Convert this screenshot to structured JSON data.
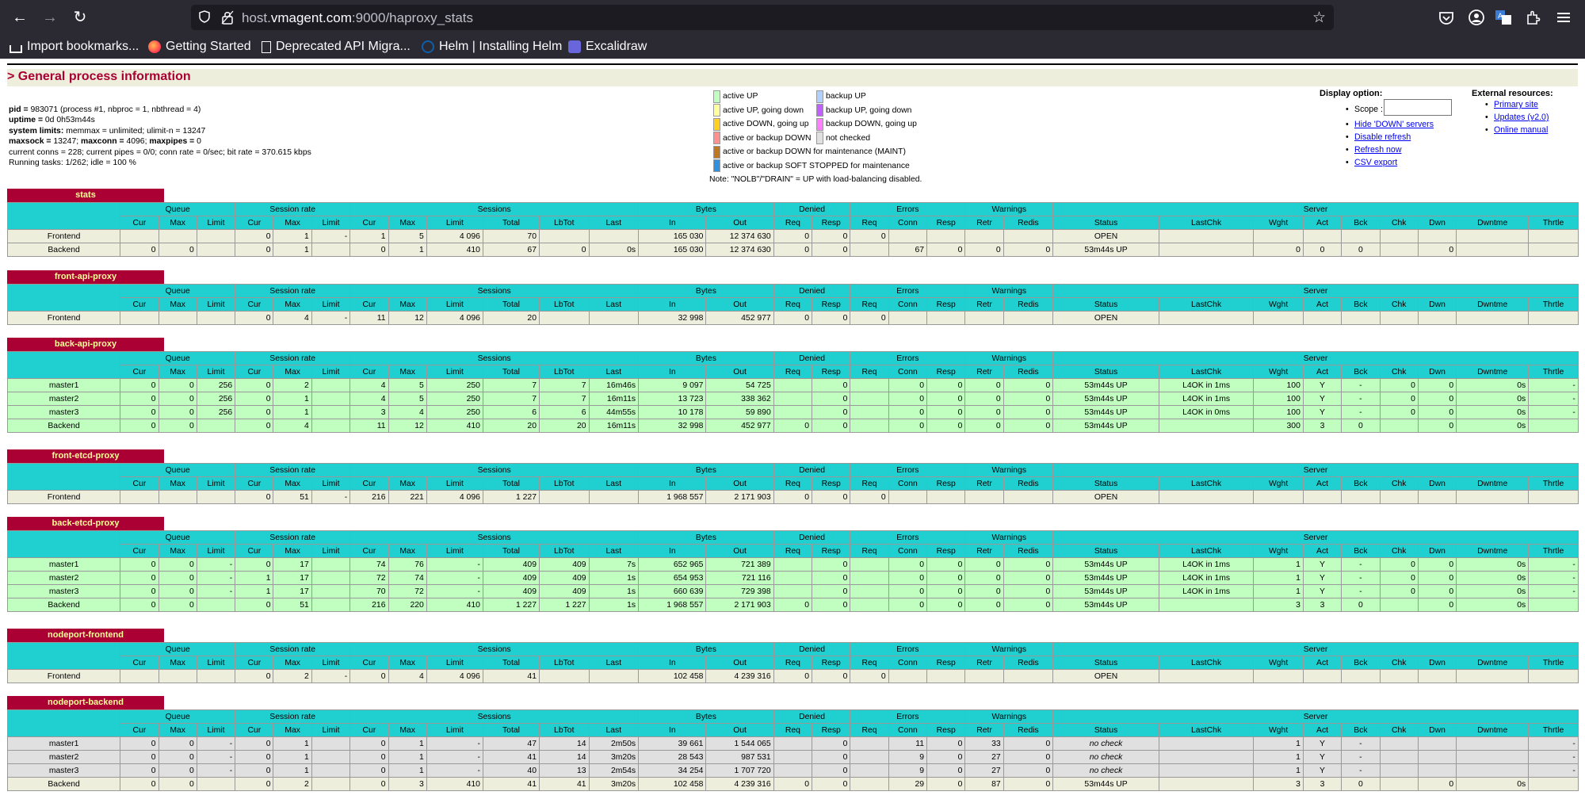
{
  "browser": {
    "url_host": "host.",
    "url_domain": "vmagent.com",
    "url_rest": ":9000/haproxy_stats",
    "bookmarks": [
      "Import bookmarks...",
      "Getting Started",
      "Deprecated API Migra...",
      "Helm | Installing Helm",
      "Excalidraw"
    ]
  },
  "general": {
    "title": "> General process information",
    "lines": [
      {
        "b": "pid = ",
        "t": "983071 (process #1, nbproc = 1, nbthread = 4)"
      },
      {
        "b": "uptime = ",
        "t": "0d 0h53m44s"
      },
      {
        "b": "system limits:",
        "t": " memmax = unlimited; ulimit-n = 13247"
      },
      {
        "b": "maxsock = ",
        "t": "13247; ",
        "b2": "maxconn = ",
        "t2": "4096; ",
        "b3": "maxpipes = ",
        "t3": "0"
      },
      {
        "b": "",
        "t": "current conns = 228; current pipes = 0/0; conn rate = 0/sec; bit rate = 370.615 kbps"
      },
      {
        "b": "",
        "t": "Running tasks: 1/262; idle = 100 %"
      }
    ]
  },
  "legend": {
    "items": [
      {
        "label": "active UP",
        "color": "#c0ffc0"
      },
      {
        "label": "active UP, going down",
        "color": "#ffffa0"
      },
      {
        "label": "active DOWN, going up",
        "color": "#ffd020"
      },
      {
        "label": "active or backup DOWN",
        "color": "#ff9090"
      },
      {
        "label": "active or backup DOWN for maintenance (MAINT)",
        "color": "#c07820"
      },
      {
        "label": "active or backup SOFT STOPPED for maintenance",
        "color": "#3090e0"
      },
      {
        "label": "backup UP",
        "color": "#b0d0ff"
      },
      {
        "label": "backup UP, going down",
        "color": "#c060ff"
      },
      {
        "label": "backup DOWN, going up",
        "color": "#ff80ff"
      },
      {
        "label": "not checked",
        "color": "#e0e0e0"
      }
    ],
    "note": "Note: \"NOLB\"/\"DRAIN\" = UP with load-balancing disabled."
  },
  "display": {
    "heading": "Display option:",
    "scope_label": "Scope :",
    "links": [
      "Hide 'DOWN' servers",
      "Disable refresh",
      "Refresh now",
      "CSV export"
    ]
  },
  "external": {
    "heading": "External resources:",
    "links": [
      "Primary site",
      "Updates (v2.0)",
      "Online manual"
    ]
  },
  "headers": {
    "groups": [
      "Queue",
      "Session rate",
      "Sessions",
      "Bytes",
      "Denied",
      "Errors",
      "Warnings",
      "Server"
    ],
    "cols": [
      "Cur",
      "Max",
      "Limit",
      "Cur",
      "Max",
      "Limit",
      "Cur",
      "Max",
      "Limit",
      "Total",
      "LbTot",
      "Last",
      "In",
      "Out",
      "Req",
      "Resp",
      "Req",
      "Conn",
      "Resp",
      "Retr",
      "Redis",
      "Status",
      "LastChk",
      "Wght",
      "Act",
      "Bck",
      "Chk",
      "Dwn",
      "Dwntme",
      "Thrtle"
    ]
  },
  "proxies": [
    {
      "name": "stats",
      "rows": [
        {
          "cls": "fe",
          "cells": [
            "Frontend",
            "",
            "",
            "",
            "0",
            "1",
            "-",
            "1",
            "5",
            "4 096",
            "70",
            "",
            "",
            "165 030",
            "12 374 630",
            "0",
            "0",
            "0",
            "",
            "",
            "",
            "",
            "OPEN",
            "",
            "",
            "",
            "",
            "",
            "",
            "",
            ""
          ]
        },
        {
          "cls": "be",
          "cells": [
            "Backend",
            "0",
            "0",
            "",
            "0",
            "1",
            "",
            "0",
            "1",
            "410",
            "67",
            "0",
            "0s",
            "165 030",
            "12 374 630",
            "0",
            "0",
            "",
            "67",
            "0",
            "0",
            "0",
            "53m44s UP",
            "",
            "0",
            "0",
            "0",
            "",
            "0",
            "",
            ""
          ]
        }
      ]
    },
    {
      "name": "front-api-proxy",
      "rows": [
        {
          "cls": "fe",
          "cells": [
            "Frontend",
            "",
            "",
            "",
            "0",
            "4",
            "-",
            "11",
            "12",
            "4 096",
            "20",
            "",
            "",
            "32 998",
            "452 977",
            "0",
            "0",
            "0",
            "",
            "",
            "",
            "",
            "OPEN",
            "",
            "",
            "",
            "",
            "",
            "",
            "",
            ""
          ]
        }
      ]
    },
    {
      "name": "back-api-proxy",
      "rows": [
        {
          "cls": "up",
          "cells": [
            "master1",
            "0",
            "0",
            "256",
            "0",
            "2",
            "",
            "4",
            "5",
            "250",
            "7",
            "7",
            "16m46s",
            "9 097",
            "54 725",
            "",
            "0",
            "",
            "0",
            "0",
            "0",
            "0",
            "53m44s UP",
            "L4OK in 1ms",
            "100",
            "Y",
            "-",
            "0",
            "0",
            "0s",
            "-"
          ]
        },
        {
          "cls": "up",
          "cells": [
            "master2",
            "0",
            "0",
            "256",
            "0",
            "1",
            "",
            "4",
            "5",
            "250",
            "7",
            "7",
            "16m11s",
            "13 723",
            "338 362",
            "",
            "0",
            "",
            "0",
            "0",
            "0",
            "0",
            "53m44s UP",
            "L4OK in 1ms",
            "100",
            "Y",
            "-",
            "0",
            "0",
            "0s",
            "-"
          ]
        },
        {
          "cls": "up",
          "cells": [
            "master3",
            "0",
            "0",
            "256",
            "0",
            "1",
            "",
            "3",
            "4",
            "250",
            "6",
            "6",
            "44m55s",
            "10 178",
            "59 890",
            "",
            "0",
            "",
            "0",
            "0",
            "0",
            "0",
            "53m44s UP",
            "L4OK in 0ms",
            "100",
            "Y",
            "-",
            "0",
            "0",
            "0s",
            "-"
          ]
        },
        {
          "cls": "up",
          "cells": [
            "Backend",
            "0",
            "0",
            "",
            "0",
            "4",
            "",
            "11",
            "12",
            "410",
            "20",
            "20",
            "16m11s",
            "32 998",
            "452 977",
            "0",
            "0",
            "",
            "0",
            "0",
            "0",
            "0",
            "53m44s UP",
            "",
            "300",
            "3",
            "0",
            "",
            "0",
            "0s",
            ""
          ]
        }
      ]
    },
    {
      "name": "front-etcd-proxy",
      "rows": [
        {
          "cls": "fe",
          "cells": [
            "Frontend",
            "",
            "",
            "",
            "0",
            "51",
            "-",
            "216",
            "221",
            "4 096",
            "1 227",
            "",
            "",
            "1 968 557",
            "2 171 903",
            "0",
            "0",
            "0",
            "",
            "",
            "",
            "",
            "OPEN",
            "",
            "",
            "",
            "",
            "",
            "",
            "",
            ""
          ]
        }
      ]
    },
    {
      "name": "back-etcd-proxy",
      "rows": [
        {
          "cls": "up",
          "cells": [
            "master1",
            "0",
            "0",
            "-",
            "0",
            "17",
            "",
            "74",
            "76",
            "-",
            "409",
            "409",
            "7s",
            "652 965",
            "721 389",
            "",
            "0",
            "",
            "0",
            "0",
            "0",
            "0",
            "53m44s UP",
            "L4OK in 1ms",
            "1",
            "Y",
            "-",
            "0",
            "0",
            "0s",
            "-"
          ]
        },
        {
          "cls": "up",
          "cells": [
            "master2",
            "0",
            "0",
            "-",
            "1",
            "17",
            "",
            "72",
            "74",
            "-",
            "409",
            "409",
            "1s",
            "654 953",
            "721 116",
            "",
            "0",
            "",
            "0",
            "0",
            "0",
            "0",
            "53m44s UP",
            "L4OK in 1ms",
            "1",
            "Y",
            "-",
            "0",
            "0",
            "0s",
            "-"
          ]
        },
        {
          "cls": "up",
          "cells": [
            "master3",
            "0",
            "0",
            "-",
            "1",
            "17",
            "",
            "70",
            "72",
            "-",
            "409",
            "409",
            "1s",
            "660 639",
            "729 398",
            "",
            "0",
            "",
            "0",
            "0",
            "0",
            "0",
            "53m44s UP",
            "L4OK in 1ms",
            "1",
            "Y",
            "-",
            "0",
            "0",
            "0s",
            "-"
          ]
        },
        {
          "cls": "up",
          "cells": [
            "Backend",
            "0",
            "0",
            "",
            "0",
            "51",
            "",
            "216",
            "220",
            "410",
            "1 227",
            "1 227",
            "1s",
            "1 968 557",
            "2 171 903",
            "0",
            "0",
            "",
            "0",
            "0",
            "0",
            "0",
            "53m44s UP",
            "",
            "3",
            "3",
            "0",
            "",
            "0",
            "0s",
            ""
          ]
        }
      ]
    },
    {
      "name": "nodeport-frontend",
      "rows": [
        {
          "cls": "fe",
          "cells": [
            "Frontend",
            "",
            "",
            "",
            "0",
            "2",
            "-",
            "0",
            "4",
            "4 096",
            "41",
            "",
            "",
            "102 458",
            "4 239 316",
            "0",
            "0",
            "0",
            "",
            "",
            "",
            "",
            "OPEN",
            "",
            "",
            "",
            "",
            "",
            "",
            "",
            ""
          ]
        }
      ]
    },
    {
      "name": "nodeport-backend",
      "rows": [
        {
          "cls": "nc",
          "cells": [
            "master1",
            "0",
            "0",
            "-",
            "0",
            "1",
            "",
            "0",
            "1",
            "-",
            "47",
            "14",
            "2m50s",
            "39 661",
            "1 544 065",
            "",
            "0",
            "",
            "11",
            "0",
            "33",
            "0",
            "no check",
            "",
            "1",
            "Y",
            "-",
            "",
            "",
            "",
            "-"
          ]
        },
        {
          "cls": "nc",
          "cells": [
            "master2",
            "0",
            "0",
            "-",
            "0",
            "1",
            "",
            "0",
            "1",
            "-",
            "41",
            "14",
            "3m20s",
            "28 543",
            "987 531",
            "",
            "0",
            "",
            "9",
            "0",
            "27",
            "0",
            "no check",
            "",
            "1",
            "Y",
            "-",
            "",
            "",
            "",
            "-"
          ]
        },
        {
          "cls": "nc",
          "cells": [
            "master3",
            "0",
            "0",
            "-",
            "0",
            "1",
            "",
            "0",
            "1",
            "-",
            "40",
            "13",
            "2m54s",
            "34 254",
            "1 707 720",
            "",
            "0",
            "",
            "9",
            "0",
            "27",
            "0",
            "no check",
            "",
            "1",
            "Y",
            "-",
            "",
            "",
            "",
            "-"
          ]
        },
        {
          "cls": "be",
          "cells": [
            "Backend",
            "0",
            "0",
            "",
            "0",
            "2",
            "",
            "0",
            "3",
            "410",
            "41",
            "41",
            "3m20s",
            "102 458",
            "4 239 316",
            "0",
            "0",
            "",
            "29",
            "0",
            "87",
            "0",
            "53m44s UP",
            "",
            "3",
            "3",
            "0",
            "",
            "0",
            "0s",
            ""
          ]
        }
      ]
    }
  ]
}
